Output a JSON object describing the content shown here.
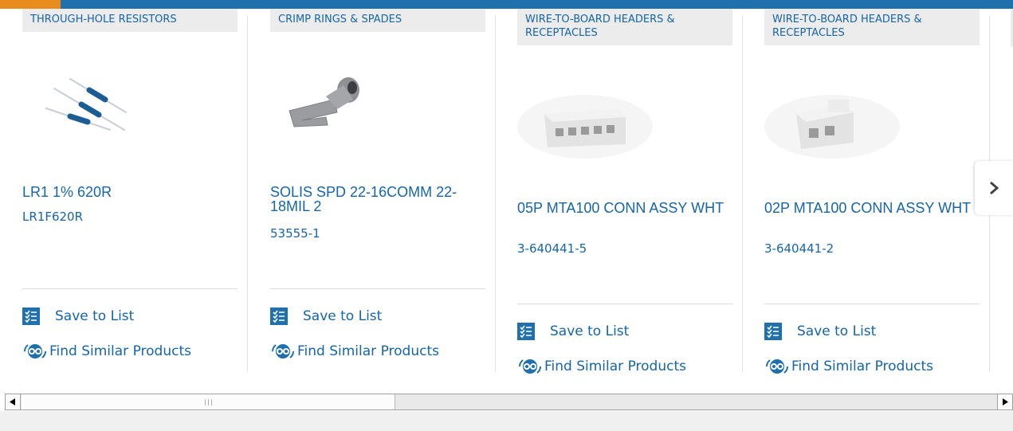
{
  "carousel": {
    "products": [
      {
        "category": "THROUGH-HOLE RESISTORS",
        "name": "LR1 1% 620R",
        "part_number": "LR1F620R",
        "save_label": "Save to List",
        "similar_label": "Find Similar Products",
        "image_icon": "resistor-product-image"
      },
      {
        "category": "CRIMP RINGS & SPADES",
        "name": "SOLIS SPD 22-16COMM 22-18MIL 2",
        "part_number": "53555-1",
        "save_label": "Save to List",
        "similar_label": "Find Similar Products",
        "image_icon": "spade-terminal-product-image"
      },
      {
        "category": "WIRE-TO-BOARD HEADERS & RECEPTACLES",
        "name": "05P MTA100 CONN ASSY WHT",
        "part_number": "3-640441-5",
        "save_label": "Save to List",
        "similar_label": "Find Similar Products",
        "image_icon": "connector-5pos-product-image"
      },
      {
        "category": "WIRE-TO-BOARD HEADERS & RECEPTACLES",
        "name": "02P MTA100 CONN ASSY WHT",
        "part_number": "3-640441-2",
        "save_label": "Save to List",
        "similar_label": "Find Similar Products",
        "image_icon": "connector-2pos-product-image"
      }
    ],
    "next_icon": "chevron-right-icon"
  },
  "colors": {
    "accent_blue": "#1f70ad",
    "accent_orange": "#e88c1e",
    "link_blue": "#1565a8",
    "category_bg": "#ececec"
  }
}
